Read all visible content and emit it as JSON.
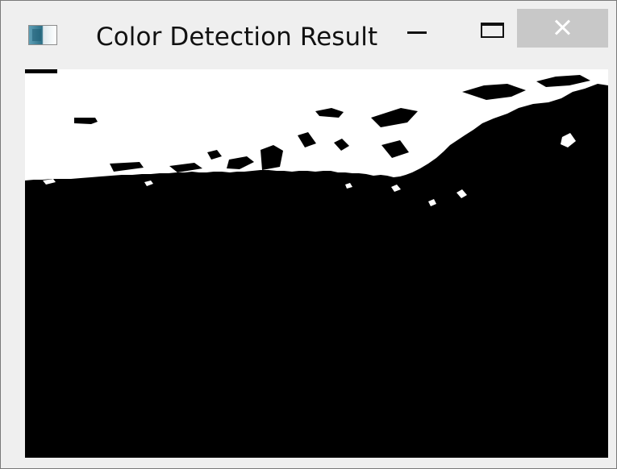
{
  "window": {
    "title": "Color Detection Result",
    "controls": {
      "minimize": "minimize",
      "maximize": "maximize",
      "close": "close"
    }
  },
  "content": {
    "image": "binary color-detection mask"
  }
}
